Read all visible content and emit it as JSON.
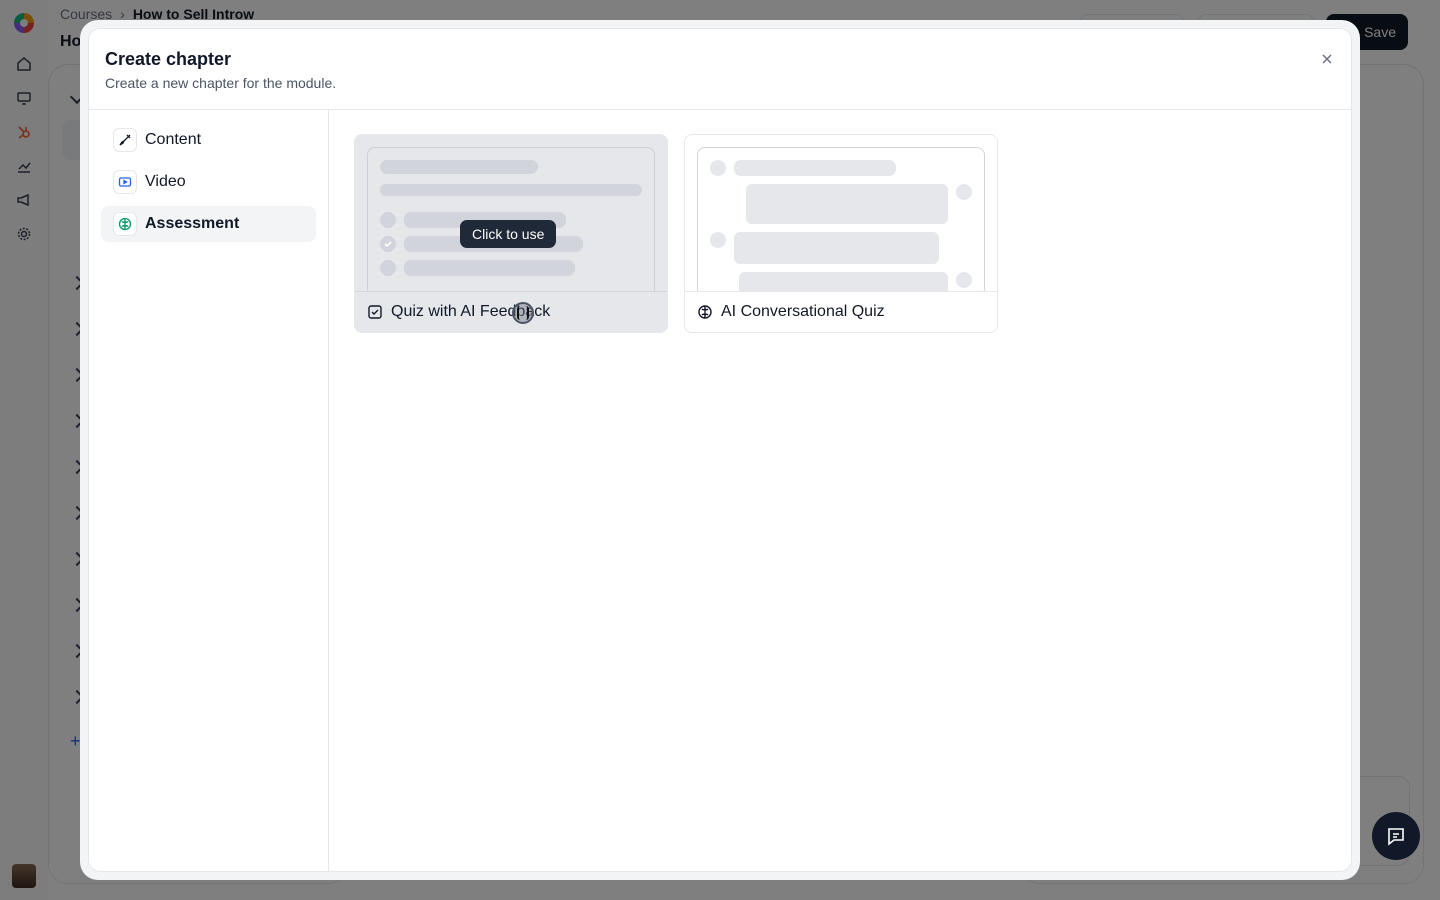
{
  "background": {
    "breadcrumb": [
      "Courses",
      "How to Sell Introw"
    ],
    "page_title": "Ho",
    "save_label": "Save",
    "add_label": "+"
  },
  "modal": {
    "title": "Create chapter",
    "description": "Create a new chapter for the module.",
    "categories": [
      {
        "label": "Content",
        "icon": "brush-icon",
        "active": false
      },
      {
        "label": "Video",
        "icon": "video-icon",
        "active": false
      },
      {
        "label": "Assessment",
        "icon": "brain-icon",
        "active": true
      }
    ],
    "templates": [
      {
        "label": "Quiz with AI Feedback",
        "icon": "checkbox-icon",
        "hovered": true
      },
      {
        "label": "AI Conversational Quiz",
        "icon": "brain-icon",
        "hovered": false
      }
    ],
    "tooltip": "Click to use"
  },
  "colors": {
    "accent_dark": "#111827",
    "overlay": "rgba(0,0,0,0.5)",
    "hover": "#e5e7eb",
    "video_icon": "#2563eb",
    "assessment_icon": "#059669"
  }
}
